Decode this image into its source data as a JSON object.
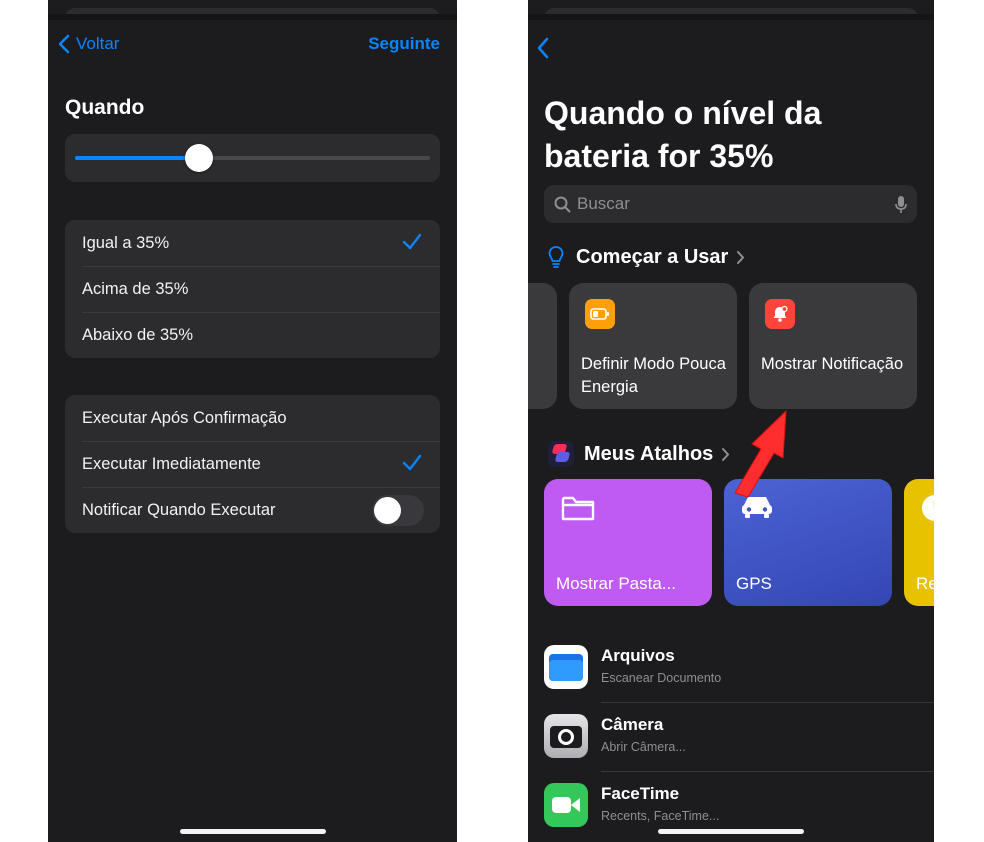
{
  "left": {
    "nav": {
      "back_label": "Voltar",
      "next_label": "Seguinte"
    },
    "section_title": "Quando",
    "slider": {
      "value_percent": 35
    },
    "options": [
      {
        "label": "Igual a 35%",
        "selected": true
      },
      {
        "label": "Acima de 35%",
        "selected": false
      },
      {
        "label": "Abaixo de 35%",
        "selected": false
      }
    ],
    "execution": [
      {
        "label": "Executar Após Confirmação",
        "selected": false
      },
      {
        "label": "Executar Imediatamente",
        "selected": true
      },
      {
        "label": "Notificar Quando Executar",
        "toggle_on": false
      }
    ]
  },
  "right": {
    "title": "Quando o nível da bateria for 35%",
    "search": {
      "placeholder": "Buscar"
    },
    "getting_started": {
      "heading": "Começar a Usar",
      "cards": [
        {
          "label": "Definir Modo Pouca Energia",
          "icon": "battery-icon",
          "color": "#ff9f0a"
        },
        {
          "label": "Mostrar Notificação",
          "icon": "bell-icon",
          "color": "#ff453a"
        }
      ]
    },
    "my_shortcuts": {
      "heading": "Meus Atalhos",
      "cards": [
        {
          "label": "Mostrar Pasta...",
          "icon": "folder-icon",
          "color": "#bf5af2"
        },
        {
          "label": "GPS",
          "icon": "car-icon",
          "color": "#3f56c4"
        },
        {
          "label": "Re",
          "icon": "clock-icon",
          "color": "#e6c200"
        }
      ]
    },
    "apps": [
      {
        "name": "Arquivos",
        "subtitle": "Escanear Documento",
        "icon": "files-app-icon"
      },
      {
        "name": "Câmera",
        "subtitle": "Abrir Câmera...",
        "icon": "camera-app-icon"
      },
      {
        "name": "FaceTime",
        "subtitle": "Recents, FaceTime...",
        "icon": "facetime-app-icon"
      }
    ]
  },
  "colors": {
    "accent": "#0a84ff",
    "background": "#1c1c1e",
    "card": "#2c2c2e",
    "arrow": "#ff2d2d"
  }
}
